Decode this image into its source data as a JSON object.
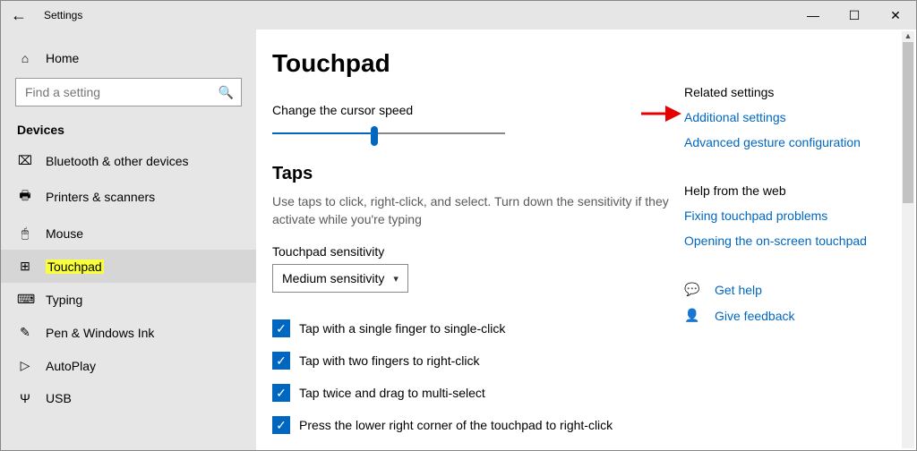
{
  "titlebar": {
    "app_name": "Settings"
  },
  "sidebar": {
    "home": "Home",
    "search_placeholder": "Find a setting",
    "category": "Devices",
    "items": [
      {
        "label": "Bluetooth & other devices",
        "glyph": "⌧"
      },
      {
        "label": "Printers & scanners",
        "glyph": "🖶"
      },
      {
        "label": "Mouse",
        "glyph": "🖱"
      },
      {
        "label": "Touchpad",
        "glyph": "⊞",
        "selected": true,
        "highlight": true
      },
      {
        "label": "Typing",
        "glyph": "⌨"
      },
      {
        "label": "Pen & Windows Ink",
        "glyph": "✎"
      },
      {
        "label": "AutoPlay",
        "glyph": "▷"
      },
      {
        "label": "USB",
        "glyph": "Ψ"
      }
    ]
  },
  "main": {
    "title": "Touchpad",
    "cursor_speed_label": "Change the cursor speed",
    "cursor_speed_percent": 44,
    "taps_heading": "Taps",
    "taps_desc": "Use taps to click, right-click, and select. Turn down the sensitivity if they activate while you're typing",
    "sensitivity_label": "Touchpad sensitivity",
    "sensitivity_value": "Medium sensitivity",
    "checks": [
      "Tap with a single finger to single-click",
      "Tap with two fingers to right-click",
      "Tap twice and drag to multi-select",
      "Press the lower right corner of the touchpad to right-click"
    ]
  },
  "right": {
    "related_head": "Related settings",
    "links": [
      "Additional settings",
      "Advanced gesture configuration"
    ],
    "help_head": "Help from the web",
    "help_links": [
      "Fixing touchpad problems",
      "Opening the on-screen touchpad"
    ],
    "get_help": "Get help",
    "feedback": "Give feedback"
  }
}
